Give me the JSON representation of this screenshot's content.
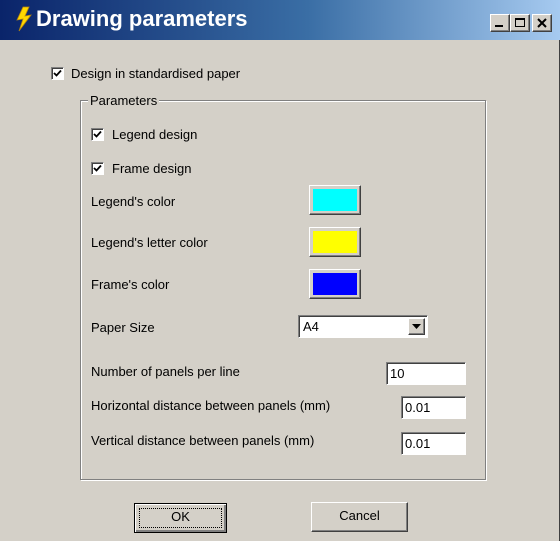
{
  "window": {
    "title": "Drawing parameters"
  },
  "standard_paper": {
    "label": "Design in standardised paper",
    "checked": true
  },
  "parameters_group": {
    "title": "Parameters",
    "legend_design": {
      "label": "Legend design",
      "checked": true
    },
    "frame_design": {
      "label": "Frame design",
      "checked": true
    },
    "legend_color": {
      "label": "Legend's color",
      "color": "#00ffff"
    },
    "legend_letter_color": {
      "label": "Legend's letter color",
      "color": "#ffff00"
    },
    "frame_color": {
      "label": "Frame's color",
      "color": "#0000ff"
    },
    "paper_size": {
      "label": "Paper Size",
      "value": "A4"
    },
    "panels_per_line": {
      "label": "Number of panels per line",
      "value": "10"
    },
    "horizontal_distance": {
      "label": "Horizontal distance between panels (mm)",
      "value": "0.01"
    },
    "vertical_distance": {
      "label": "Vertical distance between panels (mm)",
      "value": "0.01"
    }
  },
  "buttons": {
    "ok": "OK",
    "cancel": "Cancel"
  }
}
